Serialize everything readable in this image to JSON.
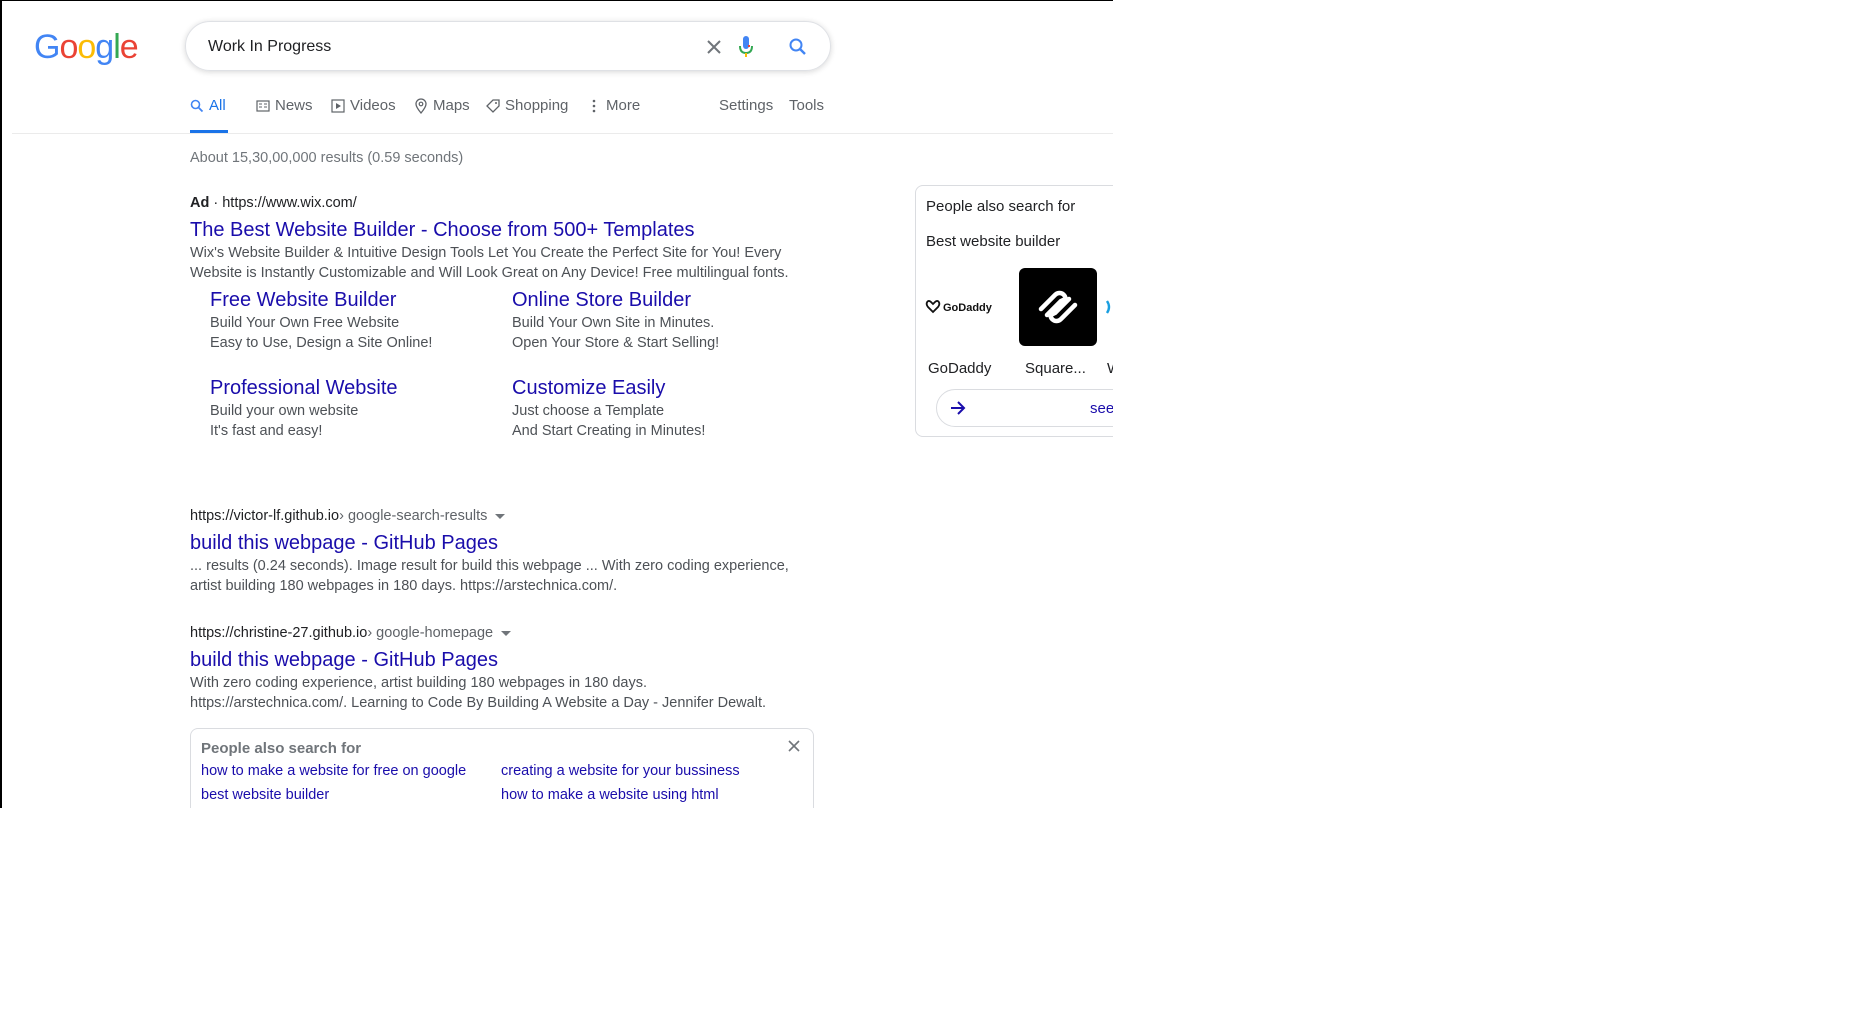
{
  "logo": {
    "letters": [
      {
        "ch": "G",
        "color": "#4285F4"
      },
      {
        "ch": "o",
        "color": "#EA4335"
      },
      {
        "ch": "o",
        "color": "#FBBC05"
      },
      {
        "ch": "g",
        "color": "#4285F4"
      },
      {
        "ch": "l",
        "color": "#34A853"
      },
      {
        "ch": "e",
        "color": "#EA4335"
      }
    ]
  },
  "search": {
    "query": "Work In Progress",
    "clear_icon": "close-icon",
    "mic_icon": "mic-icon",
    "search_icon": "search-icon"
  },
  "tabs": {
    "all": "All",
    "news": "News",
    "videos": "Videos",
    "maps": "Maps",
    "shopping": "Shopping",
    "more": "More",
    "settings": "Settings",
    "tools": "Tools"
  },
  "result_stats": "About 15,30,00,000 results (0.59 seconds)",
  "ad": {
    "label": "Ad",
    "separator": " · ",
    "url": "https://www.wix.com/",
    "title": "The Best Website Builder - Choose from 500+ Templates",
    "snippet_line1": "Wix's Website Builder & Intuitive Design Tools Let You Create the Perfect Site for You! Every",
    "snippet_line2": "Website is Instantly Customizable and Will Look Great on Any Device! Free multilingual fonts.",
    "sitelinks": [
      {
        "title": "Free Website Builder",
        "line1": "Build Your Own Free Website",
        "line2": "Easy to Use, Design a Site Online!"
      },
      {
        "title": "Online Store Builder",
        "line1": "Build Your Own Site in Minutes.",
        "line2": "Open Your Store & Start Selling!"
      },
      {
        "title": "Professional Website",
        "line1": "Build your own website",
        "line2": "It's fast and easy!"
      },
      {
        "title": "Customize Easily",
        "line1": "Just choose a Template",
        "line2": "And Start Creating in Minutes!"
      }
    ]
  },
  "results": [
    {
      "domain": "https://victor-lf.github.io",
      "crumb": " › google-search-results",
      "title": "build this webpage - GitHub Pages",
      "line1": "... results (0.24 seconds). Image result for build this webpage ... With zero coding experience,",
      "line2": "artist building 180 webpages in 180 days. https://arstechnica.com/."
    },
    {
      "domain": "https://christine-27.github.io",
      "crumb": " › google-homepage",
      "title": "build this webpage - GitHub Pages",
      "line1": "With zero coding experience, artist building 180 webpages in 180 days.",
      "line2": "https://arstechnica.com/. Learning to Code By Building A Website a Day - Jennifer Dewalt."
    }
  ],
  "pasf": {
    "title": "People also search for",
    "links": [
      "how to make a website for free on google",
      "creating a website for your bussiness",
      "best website builder",
      "how to make a website using html"
    ]
  },
  "side_panel": {
    "title": "People also search for",
    "subtitle": "Best website builder",
    "cards": [
      {
        "name": "GoDaddy",
        "logo_text": "GoDaddy"
      },
      {
        "name": "Square...",
        "logo_text": ""
      },
      {
        "name": "W",
        "logo_text": ""
      }
    ],
    "see_more": "see"
  },
  "colors": {
    "link": "#1a0dab",
    "accent": "#1a73e8",
    "muted": "#70757a"
  }
}
